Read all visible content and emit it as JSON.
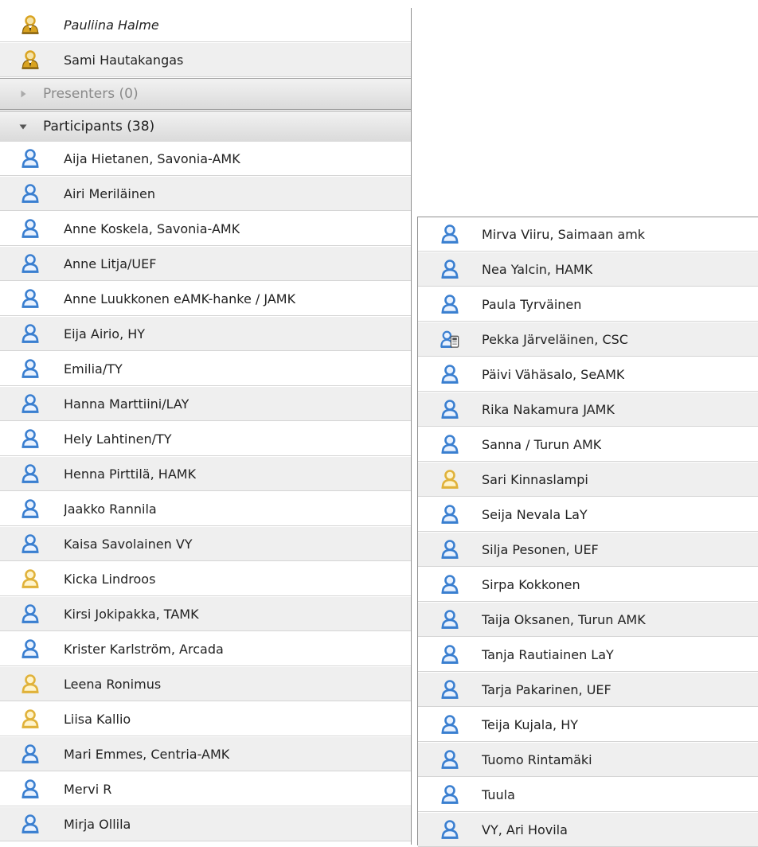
{
  "hosts": [
    {
      "name": "Pauliina Halme",
      "role": "host"
    },
    {
      "name": "Sami Hautakangas",
      "role": "host"
    }
  ],
  "presenters_header": {
    "label": "Presenters (0)",
    "expanded": false
  },
  "participants_header": {
    "label": "Participants (38)",
    "expanded": true
  },
  "participants_left": [
    {
      "name": "Aija Hietanen, Savonia-AMK",
      "icon": "blue-participant-icon"
    },
    {
      "name": "Airi Meriläinen",
      "icon": "blue-participant-icon"
    },
    {
      "name": "Anne Koskela, Savonia-AMK",
      "icon": "blue-participant-icon"
    },
    {
      "name": "Anne Litja/UEF",
      "icon": "blue-participant-icon"
    },
    {
      "name": "Anne Luukkonen eAMK-hanke / JAMK",
      "icon": "blue-participant-icon"
    },
    {
      "name": "Eija Airio, HY",
      "icon": "blue-participant-icon"
    },
    {
      "name": "Emilia/TY",
      "icon": "blue-participant-icon"
    },
    {
      "name": "Hanna Marttiini/LAY",
      "icon": "blue-participant-icon"
    },
    {
      "name": "Hely Lahtinen/TY",
      "icon": "blue-participant-icon"
    },
    {
      "name": "Henna Pirttilä, HAMK",
      "icon": "blue-participant-icon"
    },
    {
      "name": "Jaakko Rannila",
      "icon": "blue-participant-icon"
    },
    {
      "name": "Kaisa Savolainen VY",
      "icon": "blue-participant-icon"
    },
    {
      "name": "Kicka Lindroos",
      "icon": "yellow-participant-icon"
    },
    {
      "name": "Kirsi Jokipakka, TAMK",
      "icon": "blue-participant-icon"
    },
    {
      "name": "Krister Karlström, Arcada",
      "icon": "blue-participant-icon"
    },
    {
      "name": "Leena Ronimus",
      "icon": "yellow-participant-icon"
    },
    {
      "name": "Liisa Kallio",
      "icon": "yellow-participant-icon"
    },
    {
      "name": "Mari Emmes, Centria-AMK",
      "icon": "blue-participant-icon"
    },
    {
      "name": "Mervi R",
      "icon": "blue-participant-icon"
    },
    {
      "name": "Mirja Ollila",
      "icon": "blue-participant-icon"
    }
  ],
  "participants_right": [
    {
      "name": "Mirva Viiru, Saimaan amk",
      "icon": "blue-participant-icon"
    },
    {
      "name": "Nea Yalcin, HAMK",
      "icon": "blue-participant-icon"
    },
    {
      "name": "Paula Tyrväinen",
      "icon": "blue-participant-icon"
    },
    {
      "name": "Pekka Järveläinen, CSC",
      "icon": "phone-participant-icon"
    },
    {
      "name": "Päivi Vähäsalo, SeAMK",
      "icon": "blue-participant-icon"
    },
    {
      "name": "Rika Nakamura JAMK",
      "icon": "blue-participant-icon"
    },
    {
      "name": "Sanna / Turun AMK",
      "icon": "blue-participant-icon"
    },
    {
      "name": "Sari Kinnaslampi",
      "icon": "yellow-participant-icon"
    },
    {
      "name": "Seija Nevala LaY",
      "icon": "blue-participant-icon"
    },
    {
      "name": "Silja Pesonen, UEF",
      "icon": "blue-participant-icon"
    },
    {
      "name": "Sirpa Kokkonen",
      "icon": "blue-participant-icon"
    },
    {
      "name": "Taija Oksanen, Turun AMK",
      "icon": "blue-participant-icon"
    },
    {
      "name": "Tanja Rautiainen LaY",
      "icon": "blue-participant-icon"
    },
    {
      "name": "Tarja Pakarinen, UEF",
      "icon": "blue-participant-icon"
    },
    {
      "name": "Teija Kujala, HY",
      "icon": "blue-participant-icon"
    },
    {
      "name": "Tuomo Rintamäki",
      "icon": "blue-participant-icon"
    },
    {
      "name": "Tuula",
      "icon": "blue-participant-icon"
    },
    {
      "name": "VY, Ari Hovila",
      "icon": "blue-participant-icon"
    }
  ],
  "colors": {
    "participant_blue": "#3a7fd0",
    "participant_yellow": "#e0b23a",
    "host_gold": "#d9a321",
    "row_alt": "#efefef",
    "divider": "#d4d4d4"
  }
}
